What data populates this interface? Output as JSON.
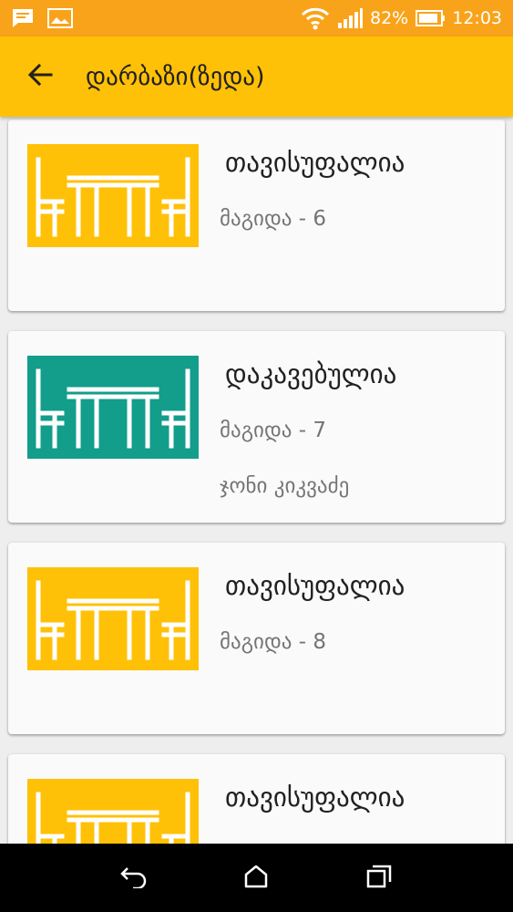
{
  "status_bar": {
    "battery": "82%",
    "time": "12:03",
    "icons": [
      "chat-notification-icon",
      "image-notification-icon",
      "wifi-icon",
      "signal-icon",
      "battery-icon"
    ]
  },
  "app_bar": {
    "title": "დარბაზი(ზედა)",
    "back_icon": "arrow-back-icon"
  },
  "colors": {
    "status_bar": "#f9a31a",
    "app_bar": "#ffc107",
    "free": "#ffc107",
    "occupied": "#139d8b"
  },
  "cards": [
    {
      "status": "თავისუფალია",
      "table": "მაგიდა - 6",
      "waiter": "",
      "state_color": "#ffc107"
    },
    {
      "status": "დაკავებულია",
      "table": "მაგიდა - 7",
      "waiter": "ჯონი  კიკვაძე",
      "state_color": "#139d8b"
    },
    {
      "status": "თავისუფალია",
      "table": "მაგიდა - 8",
      "waiter": "",
      "state_color": "#ffc107"
    },
    {
      "status": "თავისუფალია",
      "table": "",
      "waiter": "",
      "state_color": "#ffc107"
    }
  ],
  "nav_bar": {
    "icons": [
      "back-nav-icon",
      "home-nav-icon",
      "recents-nav-icon"
    ]
  }
}
